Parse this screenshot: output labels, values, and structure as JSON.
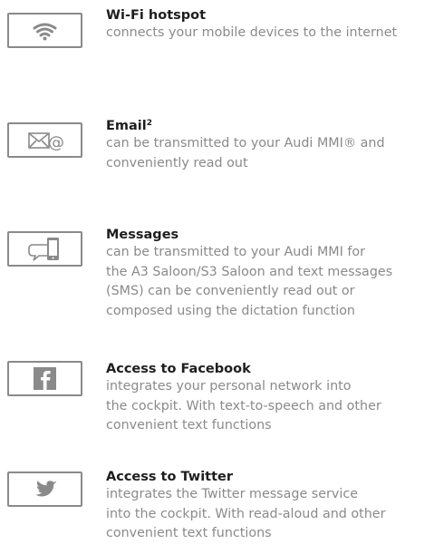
{
  "features": [
    {
      "title": "Wi-Fi hotspot",
      "lines": [
        "connects your mobile devices to the internet"
      ],
      "icon": "wifi-icon"
    },
    {
      "title": "Email",
      "title_sup": "2",
      "lines": [
        "can be transmitted to your Audi MMI® and",
        "conveniently read out"
      ],
      "icon": "email-icon"
    },
    {
      "title": "Messages",
      "lines": [
        "can be transmitted to your Audi MMI for",
        "the A3 Saloon/S3 Saloon and text messages",
        "(SMS) can be conveniently read out or",
        "composed using the dictation function"
      ],
      "icon": "messages-icon"
    },
    {
      "title": "Access to Facebook",
      "lines": [
        "integrates your personal network into",
        "the cockpit. With text-to-speech and other",
        "convenient text functions"
      ],
      "icon": "facebook-icon"
    },
    {
      "title": "Access to Twitter",
      "lines": [
        "integrates the Twitter message service",
        "into the cockpit. With read-aloud and other",
        "convenient text functions"
      ],
      "icon": "twitter-icon"
    }
  ],
  "colors": {
    "icon_gray": "#8a8a8a",
    "title": "#1e1e1e",
    "description": "#8a8a8a"
  }
}
